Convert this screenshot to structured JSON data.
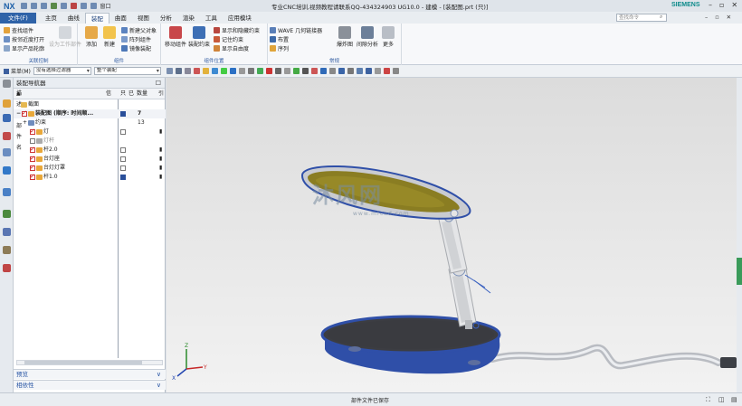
{
  "title_bar": {
    "logo": "NX",
    "window_label": "窗口",
    "title": "专业CNC培训,视频教程请联系QQ-434324903 UG10.0 - 建模 - [装配图.prt  (只)]",
    "brand": "SIEMENS"
  },
  "menu_tabs": [
    {
      "label": "文件(F)"
    },
    {
      "label": "主页"
    },
    {
      "label": "曲线"
    },
    {
      "label": "装配"
    },
    {
      "label": "曲面"
    },
    {
      "label": "视图"
    },
    {
      "label": "分析"
    },
    {
      "label": "渲染"
    },
    {
      "label": "工具"
    },
    {
      "label": "应用模块"
    }
  ],
  "search": {
    "placeholder": "查找命令"
  },
  "ribbon": {
    "groups": [
      {
        "name": "关联控制"
      },
      {
        "name": "组件"
      },
      {
        "name": "组件位置"
      },
      {
        "name": "常规"
      }
    ],
    "items": {
      "find_component": "查找组件",
      "open_by_proximity": "按邻近度打开",
      "show_product_outline": "显示产品轮廓",
      "set_work_part": "设为工作部件",
      "add": "添加",
      "new": "新建",
      "new_parent": "新建父对象",
      "array_component": "阵列组件",
      "mirror_assembly": "镜像装配",
      "move_component": "移动组件",
      "assembly_constraints": "装配约束",
      "show_hide_constraints": "显示和隐藏约束",
      "remember_constraints": "记住约束",
      "show_dof": "显示自由度",
      "wave_linker": "WAVE 几何链接器",
      "layout": "布置",
      "sequence": "序列",
      "exploded_view": "爆炸图",
      "interference_analysis": "间隙分析",
      "more": "更多"
    }
  },
  "toolbar": {
    "menu_label": "菜单(M)",
    "selection_filter": "没有选择过滤器",
    "scope": "整个装配"
  },
  "navigator": {
    "title": "装配导航器",
    "columns": {
      "name": "描述性部件名",
      "info": "信",
      "readonly": "只",
      "modified": "已",
      "count": "数量",
      "ref": "引"
    },
    "rows": [
      {
        "label": "截面",
        "level": 1,
        "icon": "folder-icon",
        "checked": false,
        "count": ""
      },
      {
        "label": "装配图 (顺序: 时间顺...",
        "level": 1,
        "icon": "assembly-icon",
        "checked": true,
        "count": "7",
        "bold": true
      },
      {
        "label": "约束",
        "level": 2,
        "icon": "constraints-icon",
        "checked": false,
        "count": "13"
      },
      {
        "label": "灯",
        "level": 2,
        "icon": "part-icon",
        "checked": true,
        "count": ""
      },
      {
        "label": "灯杆",
        "level": 2,
        "icon": "part-icon",
        "checked": false,
        "count": "",
        "grey": true
      },
      {
        "label": "杆2.0",
        "level": 2,
        "icon": "part-icon",
        "checked": true,
        "count": ""
      },
      {
        "label": "台灯座",
        "level": 2,
        "icon": "part-icon",
        "checked": true,
        "count": ""
      },
      {
        "label": "台灯灯罩",
        "level": 2,
        "icon": "part-icon",
        "checked": true,
        "count": ""
      },
      {
        "label": "杆1.0",
        "level": 2,
        "icon": "part-icon",
        "checked": true,
        "count": ""
      }
    ],
    "panels": [
      {
        "label": "预览"
      },
      {
        "label": "相依性"
      }
    ]
  },
  "watermark": {
    "text": "沐风网",
    "url": "www.mfcad.com"
  },
  "status": {
    "message": "部件文件已保存"
  },
  "colors": {
    "file_tab": "#2f63a8",
    "base_blue": "#2f4fa8",
    "shade_yellow": "#8a7d22",
    "brand": "#0b8a8a"
  }
}
